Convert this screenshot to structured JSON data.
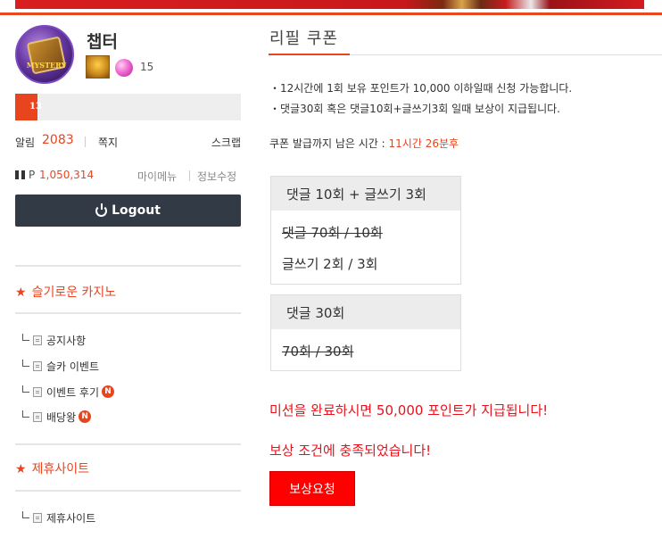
{
  "user": {
    "name": "챕터",
    "avatar_text": "MYSTERY",
    "level": "15",
    "exp_label": "13",
    "exp_fraction": 0.1
  },
  "status": {
    "notif_label": "알림",
    "notif_count": "2083",
    "memo_label": "쪽지",
    "scrap_label": "스크랩",
    "points_prefix": "P",
    "points_value": "1,050,314",
    "mymenu_label": "마이메뉴",
    "editinfo_label": "정보수정"
  },
  "logout": {
    "label": "Logout"
  },
  "sections": [
    {
      "title": "슬기로운 카지노",
      "items": [
        {
          "label": "공지사항",
          "badge": ""
        },
        {
          "label": "슬카 이벤트",
          "badge": ""
        },
        {
          "label": "이벤트 후기",
          "badge": "N"
        },
        {
          "label": "배당왕",
          "badge": "N"
        }
      ]
    },
    {
      "title": "제휴사이트",
      "items": [
        {
          "label": "제휴사이트",
          "badge": ""
        }
      ]
    }
  ],
  "main": {
    "title": "리필 쿠폰",
    "notices": [
      "・12시간에 1회 보유 포인트가 10,000 이하일때 신청 가능합니다.",
      "・댓글30회 혹은 댓글10회+글쓰기3회 일때 보상이 지급됩니다."
    ],
    "countdown_label": "쿠폰 발급까지 남은 시간 :",
    "countdown_value": "11시간 26분후",
    "box1": {
      "title": "댓글 10회 + 글쓰기 3회",
      "line1": "댓글 70회 / 10회",
      "line2": "글쓰기 2회 / 3회"
    },
    "box2": {
      "title": "댓글 30회",
      "line1": "70회 / 30회"
    },
    "mission_message": "미션을 완료하시면 50,000 포인트가 지급됩니다!",
    "reward_message": "보상 조건에 충족되었습니다!",
    "reward_button": "보상요청"
  },
  "colors": {
    "accent": "#e8451f",
    "alert_red": "#e8101b",
    "button_red": "#ff0000",
    "logout_bg": "#323a45"
  }
}
